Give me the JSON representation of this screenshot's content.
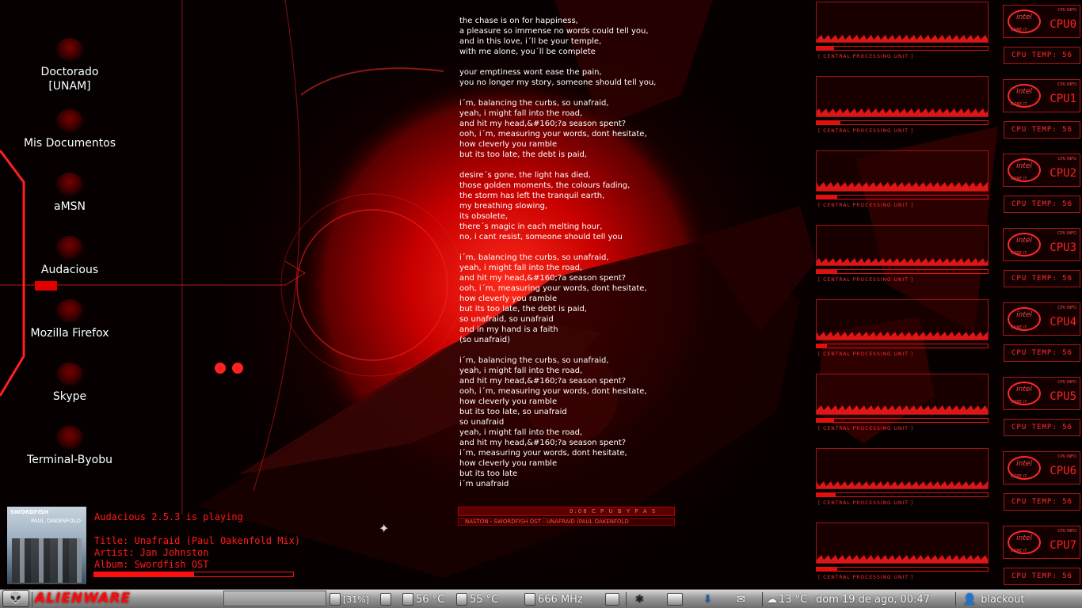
{
  "desktop": {
    "icons": [
      {
        "label": "Doctorado\n[UNAM]"
      },
      {
        "label": "Mis Documentos"
      },
      {
        "label": "aMSN"
      },
      {
        "label": "Audacious"
      },
      {
        "label": "Mozilla Firefox"
      },
      {
        "label": "Skype"
      },
      {
        "label": "Terminal-Byobu"
      }
    ]
  },
  "lyrics": [
    [
      "the chase is on for happiness,",
      "a pleasure so immense no words could tell you,",
      "and in this love, i´ll be your temple,",
      "with me alone, you´ll be complete"
    ],
    [
      "your emptiness wont ease the pain,",
      "you no longer my story, someone should tell you,"
    ],
    [
      "i´m, balancing the curbs, so unafraid,",
      "yeah, i might fall into the road,",
      "and hit my head,&#160;?a season spent?",
      "ooh, i´m, measuring your words, dont hesitate,",
      "how cleverly you ramble",
      "but its too late, the debt is paid,"
    ],
    [
      "desire´s gone, the light has died,",
      "those golden moments, the colours fading,",
      "the storm has left the tranquil earth,",
      "my breathing slowing,",
      "its obsolete,",
      "there´s magic in each melting hour,",
      "no, i cant resist, someone should tell you"
    ],
    [
      "i´m, balancing the curbs, so unafraid,",
      "yeah, i might fall into the road,",
      "and hit my head,&#160;?a season spent?",
      "ooh, i´m, measuring your words, dont hesitate,",
      "how cleverly you ramble",
      "but its too late, the debt is paid,",
      "so unafraid, so unafraid",
      "and in my hand is a faith",
      "(so unafraid)"
    ],
    [
      "i´m, balancing the curbs, so unafraid,",
      "yeah, i might fall into the road,",
      "and hit my head,&#160;?a season spent?",
      "ooh, i´m, measuring your words, dont hesitate,",
      "how cleverly you ramble",
      "but its too late, so unafraid",
      "so unafraid",
      "yeah, i might fall into the road,",
      "and hit my head,&#160;?a season spent?",
      "i´m, measuring your words, dont hesitate,",
      "how cleverly you ramble",
      "but its too late",
      "i´m unafraid"
    ]
  ],
  "mini_player": {
    "status": "0:08   C P U   B Y P A S",
    "scroll": "NASTON - SWORDFISH OST - UNAFRAID (PAUL OAKENFOLD"
  },
  "now_playing": {
    "header": "Audacious 2.5.3 is playing",
    "title": "Title: Unafraid (Paul Oakenfold Mix)",
    "artist": "Artist: Jan Johnston",
    "album": "Album: Swordfish OST",
    "progress": 0.5,
    "art_title": "SWORDFISH",
    "art_subtitle": "PAUL OAKENFOLD"
  },
  "cpus": [
    {
      "label": "CPU0",
      "temp": "CPU TEMP: 56",
      "usage": 0.1
    },
    {
      "label": "CPU1",
      "temp": "CPU TEMP: 56",
      "usage": 0.14
    },
    {
      "label": "CPU2",
      "temp": "CPU TEMP: 56",
      "usage": 0.12
    },
    {
      "label": "CPU3",
      "temp": "CPU TEMP: 56",
      "usage": 0.12
    },
    {
      "label": "CPU4",
      "temp": "CPU TEMP: 56",
      "usage": 0.06
    },
    {
      "label": "CPU5",
      "temp": "CPU TEMP: 56",
      "usage": 0.1
    },
    {
      "label": "CPU6",
      "temp": "CPU TEMP: 56",
      "usage": 0.11
    },
    {
      "label": "CPU7",
      "temp": "CPU TEMP: 56",
      "usage": 0.12
    }
  ],
  "cpu_caption": "[ CENTRAL PROCESSING UNIT ]",
  "cpu_badge": {
    "brand": "intel",
    "core": "CORE i7",
    "info": "CPU INFO"
  },
  "taskbar": {
    "logo": "ALIENWARE",
    "battery": "[31%]",
    "temp1": "56 °C",
    "temp2": "55 °C",
    "freq": "666 MHz",
    "weather": "13 °C",
    "clock": "dom 19 de ago, 00:47",
    "user": "blackout"
  },
  "colors": {
    "accent": "#ff1a1a",
    "dark_red": "#3a0000"
  }
}
